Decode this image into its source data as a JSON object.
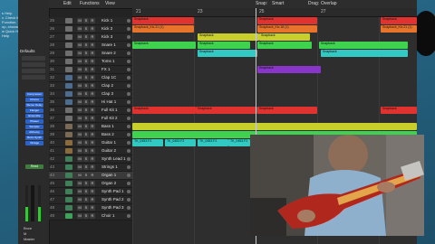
{
  "desktop": {
    "notes": [
      "s Help",
      "v. Check the",
      "Function. To hide",
      "op, choose Help >",
      "w Quick Help",
      "Help"
    ],
    "defaults_label": "Defaults"
  },
  "menubar": {
    "items": [
      "Edit",
      "Functions",
      "View",
      "Snap:",
      "Smart",
      "Drag:",
      "Overlap"
    ]
  },
  "ruler": {
    "bars": [
      "21",
      "23",
      "25",
      "27"
    ]
  },
  "inspector": {
    "buttons": [
      "Compressor",
      "Chorus",
      "Stereo Delay",
      "Flanger",
      "Ensemble",
      "Phaser",
      "Sampler",
      "Alchemy",
      "Retro Synth",
      "Vintage"
    ],
    "read_label": "Read",
    "bottom": [
      "Bnce",
      "M",
      "Master"
    ]
  },
  "tracks": [
    {
      "num": "25",
      "name": "Kick 1"
    },
    {
      "num": "26",
      "name": "Kick 2"
    },
    {
      "num": "27",
      "name": "Kick 3"
    },
    {
      "num": "28",
      "name": "Snare 1"
    },
    {
      "num": "29",
      "name": "Snare 2"
    },
    {
      "num": "30",
      "name": "Toms 1"
    },
    {
      "num": "31",
      "name": "FX 1"
    },
    {
      "num": "32",
      "name": "Clap 1C"
    },
    {
      "num": "33",
      "name": "Clap 2"
    },
    {
      "num": "34",
      "name": "Clap 3"
    },
    {
      "num": "35",
      "name": "Hi Hat 1"
    },
    {
      "num": "36",
      "name": "Full Kit 1"
    },
    {
      "num": "37",
      "name": "Full Kit 2"
    },
    {
      "num": "38",
      "name": "Bass 1"
    },
    {
      "num": "39",
      "name": "Bass 2"
    },
    {
      "num": "40",
      "name": "Guitar 1"
    },
    {
      "num": "41",
      "name": "Guitar 2"
    },
    {
      "num": "42",
      "name": "Synth Lead 1"
    },
    {
      "num": "43",
      "name": "Strings 1"
    },
    {
      "num": "44",
      "name": "Organ 1"
    },
    {
      "num": "45",
      "name": "Organ 2"
    },
    {
      "num": "46",
      "name": "Synth Pad 1"
    },
    {
      "num": "47",
      "name": "Synth Pad 2"
    },
    {
      "num": "48",
      "name": "Synth Pad 3"
    },
    {
      "num": "49",
      "name": "Choir 1"
    }
  ],
  "button_labels": {
    "mute": "M",
    "solo": "S",
    "rec": "R",
    "input": "I"
  },
  "regions": [
    {
      "lane": 0,
      "label": "Snapback",
      "color": "#e0322f"
    },
    {
      "lane": 0,
      "label": "Snapback",
      "color": "#e0322f"
    },
    {
      "lane": 0,
      "label": "Snapback",
      "color": "#e0322f"
    },
    {
      "lane": 1,
      "label": "Snapback_Kic.21 (1)",
      "color": "#e8732a"
    },
    {
      "lane": 1,
      "label": "Snapback_Kic.18 (1)",
      "color": "#e8732a"
    },
    {
      "lane": 1,
      "label": "Snapback_Kic.21 (1)",
      "color": "#e8732a"
    },
    {
      "lane": 2,
      "label": "Snapback",
      "color": "#c9cf2a"
    },
    {
      "lane": 2,
      "label": "Snapback",
      "color": "#c9cf2a"
    },
    {
      "lane": 3,
      "label": "Snapback",
      "color": "#3ed24f"
    },
    {
      "lane": 3,
      "label": "Snapback",
      "color": "#3ed24f"
    },
    {
      "lane": 3,
      "label": "Snapback",
      "color": "#3ed24f"
    },
    {
      "lane": 3,
      "label": "Snapback",
      "color": "#3ed24f"
    },
    {
      "lane": 4,
      "label": "Snapback",
      "color": "#32c9c2"
    },
    {
      "lane": 4,
      "label": "Snapback",
      "color": "#32c9c2"
    },
    {
      "lane": 6,
      "label": "Snapback",
      "color": "#8a35c9"
    },
    {
      "lane": 11,
      "label": "Snapback",
      "color": "#e0322f"
    },
    {
      "lane": 11,
      "label": "Snapback",
      "color": "#e0322f"
    },
    {
      "lane": 11,
      "label": "Snapback",
      "color": "#e0322f"
    },
    {
      "lane": 11,
      "label": "Snapback",
      "color": "#e0322f"
    },
    {
      "lane": 13,
      "label": "",
      "color": "#c9cf2a"
    },
    {
      "lane": 14,
      "label": "",
      "color": "#3ed24f"
    },
    {
      "lane": 15,
      "label": "TK_0453.F2",
      "color": "#32c9c2"
    },
    {
      "lane": 15,
      "label": "TK_0453.F2",
      "color": "#32c9c2"
    },
    {
      "lane": 15,
      "label": "TK_0453.F2",
      "color": "#32c9c2"
    },
    {
      "lane": 15,
      "label": "TK_0453.F2",
      "color": "#32c9c2"
    }
  ]
}
